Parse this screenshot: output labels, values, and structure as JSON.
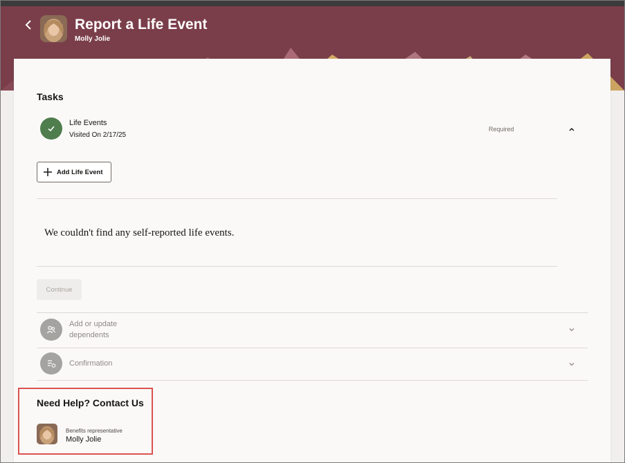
{
  "header": {
    "title": "Report a Life Event",
    "subtitle": "Molly Jolie",
    "back_icon": "chevron-left-icon"
  },
  "tasks": {
    "title": "Tasks",
    "steps": [
      {
        "label": "Life Events",
        "sub": "Visited On 2/17/25",
        "status": "Required",
        "icon": "check-icon",
        "expanded": true
      },
      {
        "label_line1": "Add or update",
        "label_line2": "dependents",
        "icon": "dependents-icon",
        "expanded": false
      },
      {
        "label": "Confirmation",
        "icon": "checklist-icon",
        "expanded": false
      }
    ],
    "add_button_label": "Add Life Event",
    "empty_message": "We couldn't find any self-reported life events.",
    "continue_label": "Continue"
  },
  "help": {
    "title": "Need Help? Contact Us",
    "role": "Benefits representative",
    "name": "Molly Jolie"
  },
  "colors": {
    "header_bg": "#7a3e4a",
    "done_step": "#4f7d4e",
    "todo_step": "#a5a3a0",
    "highlight_border": "#d9534f"
  }
}
